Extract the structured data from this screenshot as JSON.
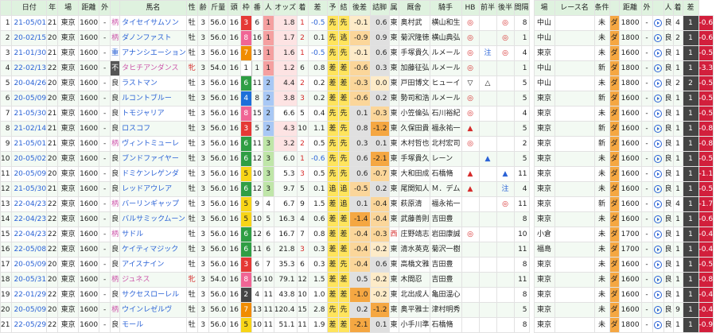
{
  "header": [
    "日付",
    "年",
    "場",
    "距離",
    "外",
    "",
    "馬名",
    "性",
    "齢",
    "斤量",
    "頭",
    "枠",
    "番",
    "人",
    "オッズ",
    "着",
    "差",
    "予",
    "結",
    "後差",
    "詰脚",
    "属",
    "厩舎",
    "騎手",
    "HB",
    "前半",
    "後半",
    "間隔",
    "",
    "場",
    "レース名",
    "条件",
    "",
    "距離",
    "外",
    "",
    "人",
    "着",
    "差"
  ],
  "rows": [
    {
      "no": "1",
      "date": "21-05/01",
      "year": "21",
      "place": "東京",
      "dist": "1600",
      "out": "-",
      "mark": "柄",
      "name": "タイセイサムソン",
      "sex": "牡",
      "age": "3",
      "kin": "56.0",
      "heads": "16",
      "waku": "3",
      "ban": "6",
      "pop": "1",
      "odds": "1.8",
      "chaku": "1",
      "sa": "-0.5",
      "yo": "先",
      "ke": "先",
      "gosa": "-0.1",
      "tsume": "0.6",
      "zoku": "東",
      "stable": "奥村武",
      "jockey": "横山和生",
      "hb": "◎",
      "zen": "",
      "kou": "◎",
      "kan": "8",
      "p_place": "中山",
      "race": "",
      "cond": "未",
      "cmark": "ダ",
      "p_dist": "1800",
      "p_out": "-",
      "p_g": "良",
      "p_pop": "4",
      "p_chaku": "1",
      "p_sa": "-0.6"
    },
    {
      "no": "2",
      "date": "20-02/15",
      "year": "20",
      "place": "東京",
      "dist": "1600",
      "out": "-",
      "mark": "柄",
      "name": "ダノンファスト",
      "sex": "牡",
      "age": "3",
      "kin": "56.0",
      "heads": "16",
      "waku": "8",
      "ban": "16",
      "pop": "1",
      "odds": "1.7",
      "chaku": "2",
      "sa": "0.1",
      "yo": "先",
      "ke": "逃",
      "gosa": "-0.9",
      "tsume": "0.9",
      "zoku": "東",
      "stable": "菊沢隆徳",
      "jockey": "横山典弘",
      "hb": "◎",
      "zen": "",
      "kou": "◎",
      "kan": "1",
      "p_place": "中山",
      "race": "",
      "cond": "未",
      "cmark": "ダ",
      "p_dist": "1800",
      "p_out": "-",
      "p_g": "良",
      "p_pop": "2",
      "p_chaku": "1",
      "p_sa": "-0.6"
    },
    {
      "no": "3",
      "date": "21-01/30",
      "year": "21",
      "place": "東京",
      "dist": "1600",
      "out": "-",
      "mark": "重",
      "name": "アナンシエーション",
      "sex": "牡",
      "age": "3",
      "kin": "56.0",
      "heads": "16",
      "waku": "7",
      "ban": "13",
      "pop": "1",
      "odds": "1.6",
      "chaku": "1",
      "sa": "-0.5",
      "yo": "先",
      "ke": "先",
      "gosa": "-0.1",
      "tsume": "0.6",
      "zoku": "東",
      "stable": "手塚貴久",
      "jockey": "ルメール",
      "hb": "◎",
      "zen": "注",
      "kou": "◎",
      "kan": "4",
      "p_place": "東京",
      "race": "",
      "cond": "未",
      "cmark": "ダ",
      "p_dist": "1600",
      "p_out": "-",
      "p_g": "良",
      "p_pop": "1",
      "p_chaku": "1",
      "p_sa": "-0.5"
    },
    {
      "no": "4",
      "date": "22-02/13",
      "year": "22",
      "place": "東京",
      "dist": "1600",
      "out": "-",
      "mark": "不",
      "name": "タヒチアンダンス",
      "sex": "牝",
      "age": "3",
      "kin": "54.0",
      "heads": "16",
      "waku": "1",
      "ban": "1",
      "pop": "1",
      "odds": "1.2",
      "chaku": "6",
      "sa": "0.8",
      "yo": "差",
      "ke": "差",
      "gosa": "-0.6",
      "tsume": "0.3",
      "zoku": "東",
      "stable": "加藤征弘",
      "jockey": "ルメール",
      "hb": "◎",
      "zen": "",
      "kou": "",
      "kan": "1",
      "p_place": "中山",
      "race": "",
      "cond": "新",
      "cmark": "ダ",
      "p_dist": "1800",
      "p_out": "-",
      "p_g": "良",
      "p_pop": "1",
      "p_chaku": "1",
      "p_sa": "-3.3"
    },
    {
      "no": "5",
      "date": "20-04/26",
      "year": "20",
      "place": "東京",
      "dist": "1600",
      "out": "-",
      "mark": "良",
      "name": "ラストマン",
      "sex": "牡",
      "age": "3",
      "kin": "56.0",
      "heads": "16",
      "waku": "6",
      "ban": "11",
      "pop": "2",
      "odds": "4.4",
      "chaku": "2",
      "sa": "0.2",
      "yo": "差",
      "ke": "差",
      "gosa": "-0.3",
      "tsume": "0.0",
      "zoku": "東",
      "stable": "戸田博文",
      "jockey": "ヒューイ",
      "hb": "▽",
      "zen": "△",
      "kou": "",
      "kan": "5",
      "p_place": "中山",
      "race": "",
      "cond": "未",
      "cmark": "ダ",
      "p_dist": "1800",
      "p_out": "-",
      "p_g": "良",
      "p_pop": "2",
      "p_chaku": "2",
      "p_sa": "-0.5"
    },
    {
      "no": "6",
      "date": "20-05/09",
      "year": "20",
      "place": "東京",
      "dist": "1600",
      "out": "-",
      "mark": "良",
      "name": "ルコントブルー",
      "sex": "牡",
      "age": "3",
      "kin": "56.0",
      "heads": "16",
      "waku": "4",
      "ban": "8",
      "pop": "2",
      "odds": "3.8",
      "chaku": "3",
      "sa": "0.2",
      "yo": "差",
      "ke": "差",
      "gosa": "-0.6",
      "tsume": "0.2",
      "zoku": "東",
      "stable": "勢司和浩",
      "jockey": "ルメール",
      "hb": "◎",
      "zen": "",
      "kou": "",
      "kan": "5",
      "p_place": "東京",
      "race": "",
      "cond": "新",
      "cmark": "ダ",
      "p_dist": "1600",
      "p_out": "-",
      "p_g": "良",
      "p_pop": "1",
      "p_chaku": "1",
      "p_sa": "-0.5"
    },
    {
      "no": "7",
      "date": "21-05/30",
      "year": "21",
      "place": "東京",
      "dist": "1600",
      "out": "-",
      "mark": "良",
      "name": "トモジャリア",
      "sex": "牡",
      "age": "3",
      "kin": "56.0",
      "heads": "16",
      "waku": "8",
      "ban": "15",
      "pop": "2",
      "odds": "6.6",
      "chaku": "5",
      "sa": "0.4",
      "yo": "先",
      "ke": "先",
      "gosa": "0.1",
      "tsume": "-0.3",
      "zoku": "東",
      "stable": "小笠倫弘",
      "jockey": "石川裕紀",
      "hb": "◎",
      "zen": "",
      "kou": "",
      "kan": "4",
      "p_place": "東京",
      "race": "",
      "cond": "未",
      "cmark": "ダ",
      "p_dist": "1600",
      "p_out": "-",
      "p_g": "良",
      "p_pop": "1",
      "p_chaku": "1",
      "p_sa": "-0.5"
    },
    {
      "no": "8",
      "date": "21-02/14",
      "year": "21",
      "place": "東京",
      "dist": "1600",
      "out": "-",
      "mark": "良",
      "name": "ロスコフ",
      "sex": "牡",
      "age": "3",
      "kin": "56.0",
      "heads": "16",
      "waku": "3",
      "ban": "5",
      "pop": "2",
      "odds": "4.3",
      "chaku": "10",
      "sa": "1.1",
      "yo": "差",
      "ke": "先",
      "gosa": "0.8",
      "tsume": "-1.2",
      "zoku": "東",
      "stable": "久保田貴",
      "jockey": "福永祐一",
      "hb": "▲",
      "zen": "",
      "kou": "",
      "kan": "5",
      "p_place": "東京",
      "race": "",
      "cond": "新",
      "cmark": "ダ",
      "p_dist": "1600",
      "p_out": "-",
      "p_g": "良",
      "p_pop": "1",
      "p_chaku": "1",
      "p_sa": "-0.8"
    },
    {
      "no": "9",
      "date": "21-05/01",
      "year": "21",
      "place": "東京",
      "dist": "1600",
      "out": "-",
      "mark": "柄",
      "name": "ヴィントミューレ",
      "sex": "牡",
      "age": "3",
      "kin": "56.0",
      "heads": "16",
      "waku": "6",
      "ban": "11",
      "pop": "3",
      "odds": "3.2",
      "chaku": "2",
      "sa": "0.5",
      "yo": "先",
      "ke": "先",
      "gosa": "0.3",
      "tsume": "0.1",
      "zoku": "東",
      "stable": "木村哲也",
      "jockey": "北村宏司",
      "hb": "◎",
      "zen": "",
      "kou": "",
      "kan": "2",
      "p_place": "東京",
      "race": "",
      "cond": "新",
      "cmark": "ダ",
      "p_dist": "1600",
      "p_out": "-",
      "p_g": "良",
      "p_pop": "1",
      "p_chaku": "1",
      "p_sa": "-0.8"
    },
    {
      "no": "10",
      "date": "20-05/02",
      "year": "20",
      "place": "東京",
      "dist": "1600",
      "out": "-",
      "mark": "良",
      "name": "ブンドファイヤー",
      "sex": "牡",
      "age": "3",
      "kin": "56.0",
      "heads": "16",
      "waku": "6",
      "ban": "12",
      "pop": "3",
      "odds": "6.0",
      "chaku": "1",
      "sa": "-0.6",
      "yo": "先",
      "ke": "先",
      "gosa": "0.6",
      "tsume": "-2.1",
      "zoku": "東",
      "stable": "手塚貴久",
      "jockey": "レーン",
      "hb": "",
      "zen": "▲",
      "kou": "",
      "kan": "5",
      "p_place": "東京",
      "race": "",
      "cond": "未",
      "cmark": "ダ",
      "p_dist": "1600",
      "p_out": "-",
      "p_g": "良",
      "p_pop": "1",
      "p_chaku": "1",
      "p_sa": "-0.5"
    },
    {
      "no": "11",
      "date": "20-05/09",
      "year": "20",
      "place": "東京",
      "dist": "1600",
      "out": "-",
      "mark": "良",
      "name": "ドミケンレゲンダ",
      "sex": "牡",
      "age": "3",
      "kin": "56.0",
      "heads": "16",
      "waku": "5",
      "ban": "10",
      "pop": "3",
      "odds": "5.3",
      "chaku": "3",
      "sa": "0.5",
      "yo": "先",
      "ke": "先",
      "gosa": "0.6",
      "tsume": "-0.7",
      "zoku": "東",
      "stable": "大和田成",
      "jockey": "石橋脩",
      "hb": "▲",
      "zen": "",
      "kou": "▲",
      "kan": "11",
      "p_place": "東京",
      "race": "",
      "cond": "未",
      "cmark": "ダ",
      "p_dist": "1600",
      "p_out": "-",
      "p_g": "良",
      "p_pop": "1",
      "p_chaku": "1",
      "p_sa": "-1.1"
    },
    {
      "no": "12",
      "date": "21-05/30",
      "year": "21",
      "place": "東京",
      "dist": "1600",
      "out": "-",
      "mark": "良",
      "name": "レッドアウレア",
      "sex": "牡",
      "age": "3",
      "kin": "56.0",
      "heads": "16",
      "waku": "6",
      "ban": "12",
      "pop": "3",
      "odds": "9.7",
      "chaku": "5",
      "sa": "0.1",
      "yo": "追",
      "ke": "追",
      "gosa": "-0.5",
      "tsume": "0.2",
      "zoku": "東",
      "stable": "尾関知人",
      "jockey": "Ｍ．デム",
      "hb": "▲",
      "zen": "",
      "kou": "注",
      "kan": "4",
      "p_place": "東京",
      "race": "",
      "cond": "未",
      "cmark": "ダ",
      "p_dist": "1600",
      "p_out": "-",
      "p_g": "良",
      "p_pop": "1",
      "p_chaku": "1",
      "p_sa": "-0.5"
    },
    {
      "no": "13",
      "date": "22-04/23",
      "year": "22",
      "place": "東京",
      "dist": "1600",
      "out": "-",
      "mark": "柄",
      "name": "バーリンギャップ",
      "sex": "牡",
      "age": "3",
      "kin": "56.0",
      "heads": "16",
      "waku": "5",
      "ban": "9",
      "pop": "4",
      "odds": "6.7",
      "chaku": "9",
      "sa": "1.5",
      "yo": "差",
      "ke": "追",
      "gosa": "0.1",
      "tsume": "-0.4",
      "zoku": "東",
      "stable": "萩原清",
      "jockey": "福永祐一",
      "hb": "",
      "zen": "",
      "kou": "◎",
      "kan": "11",
      "p_place": "東京",
      "race": "",
      "cond": "新",
      "cmark": "ダ",
      "p_dist": "1600",
      "p_out": "-",
      "p_g": "良",
      "p_pop": "4",
      "p_chaku": "1",
      "p_sa": "-1.7"
    },
    {
      "no": "14",
      "date": "22-04/23",
      "year": "22",
      "place": "東京",
      "dist": "1600",
      "out": "-",
      "mark": "良",
      "name": "バルサミックムーン",
      "sex": "牡",
      "age": "3",
      "kin": "56.0",
      "heads": "16",
      "waku": "5",
      "ban": "10",
      "pop": "5",
      "odds": "16.3",
      "chaku": "4",
      "sa": "0.6",
      "yo": "差",
      "ke": "差",
      "gosa": "-1.4",
      "tsume": "-0.4",
      "zoku": "東",
      "stable": "武藤善則",
      "jockey": "吉田豊",
      "hb": "",
      "zen": "",
      "kou": "",
      "kan": "8",
      "p_place": "東京",
      "race": "",
      "cond": "未",
      "cmark": "ダ",
      "p_dist": "1600",
      "p_out": "-",
      "p_g": "良",
      "p_pop": "1",
      "p_chaku": "1",
      "p_sa": "-0.6"
    },
    {
      "no": "15",
      "date": "22-04/23",
      "year": "22",
      "place": "東京",
      "dist": "1600",
      "out": "-",
      "mark": "柄",
      "name": "サドル",
      "sex": "牡",
      "age": "3",
      "kin": "56.0",
      "heads": "16",
      "waku": "6",
      "ban": "12",
      "pop": "6",
      "odds": "16.7",
      "chaku": "7",
      "sa": "0.8",
      "yo": "差",
      "ke": "差",
      "gosa": "-0.4",
      "tsume": "-0.3",
      "zoku": "西",
      "stable": "庄野靖志",
      "jockey": "岩田康誠",
      "hb": "◎",
      "zen": "",
      "kou": "",
      "kan": "10",
      "p_place": "小倉",
      "race": "",
      "cond": "未",
      "cmark": "ダ",
      "p_dist": "1700",
      "p_out": "-",
      "p_g": "良",
      "p_pop": "1",
      "p_chaku": "1",
      "p_sa": "-0.4"
    },
    {
      "no": "16",
      "date": "22-05/08",
      "year": "22",
      "place": "東京",
      "dist": "1600",
      "out": "-",
      "mark": "良",
      "name": "ケイティマジック",
      "sex": "牡",
      "age": "3",
      "kin": "56.0",
      "heads": "16",
      "waku": "6",
      "ban": "11",
      "pop": "6",
      "odds": "21.8",
      "chaku": "3",
      "sa": "0.3",
      "yo": "差",
      "ke": "差",
      "gosa": "-0.4",
      "tsume": "-0.2",
      "zoku": "東",
      "stable": "清水英克",
      "jockey": "菊沢一樹",
      "hb": "",
      "zen": "",
      "kou": "",
      "kan": "11",
      "p_place": "福島",
      "race": "",
      "cond": "未",
      "cmark": "ダ",
      "p_dist": "1700",
      "p_out": "-",
      "p_g": "良",
      "p_pop": "1",
      "p_chaku": "1",
      "p_sa": "-0.4"
    },
    {
      "no": "17",
      "date": "20-05/09",
      "year": "20",
      "place": "東京",
      "dist": "1600",
      "out": "-",
      "mark": "良",
      "name": "アイスナイン",
      "sex": "牡",
      "age": "3",
      "kin": "56.0",
      "heads": "16",
      "waku": "3",
      "ban": "6",
      "pop": "7",
      "odds": "35.3",
      "chaku": "6",
      "sa": "0.3",
      "yo": "差",
      "ke": "先",
      "gosa": "-0.4",
      "tsume": "0.6",
      "zoku": "東",
      "stable": "高橋文雅",
      "jockey": "吉田豊",
      "hb": "",
      "zen": "",
      "kou": "",
      "kan": "8",
      "p_place": "東京",
      "race": "",
      "cond": "未",
      "cmark": "ダ",
      "p_dist": "1600",
      "p_out": "-",
      "p_g": "良",
      "p_pop": "1",
      "p_chaku": "1",
      "p_sa": "-0.5"
    },
    {
      "no": "18",
      "date": "20-05/31",
      "year": "20",
      "place": "東京",
      "dist": "1600",
      "out": "-",
      "mark": "柄",
      "name": "ジュネス",
      "sex": "牝",
      "age": "3",
      "kin": "54.0",
      "heads": "16",
      "waku": "8",
      "ban": "16",
      "pop": "10",
      "odds": "79.1",
      "chaku": "12",
      "sa": "1.5",
      "yo": "差",
      "ke": "差",
      "gosa": "0.5",
      "tsume": "-0.2",
      "zoku": "東",
      "stable": "木間忍",
      "jockey": "吉田豊",
      "hb": "",
      "zen": "",
      "kou": "",
      "kan": "11",
      "p_place": "東京",
      "race": "",
      "cond": "未",
      "cmark": "ダ",
      "p_dist": "1600",
      "p_out": "-",
      "p_g": "良",
      "p_pop": "1",
      "p_chaku": "1",
      "p_sa": "-0.8"
    },
    {
      "no": "19",
      "date": "22-01/29",
      "year": "22",
      "place": "東京",
      "dist": "1600",
      "out": "-",
      "mark": "良",
      "name": "サクセスローレル",
      "sex": "牡",
      "age": "3",
      "kin": "56.0",
      "heads": "16",
      "waku": "2",
      "ban": "4",
      "pop": "11",
      "odds": "43.8",
      "chaku": "10",
      "sa": "1.0",
      "yo": "差",
      "ke": "差",
      "gosa": "-1.0",
      "tsume": "-0.2",
      "zoku": "東",
      "stable": "北出成人",
      "jockey": "亀田温心",
      "hb": "",
      "zen": "",
      "kou": "",
      "kan": "8",
      "p_place": "東京",
      "race": "",
      "cond": "未",
      "cmark": "ダ",
      "p_dist": "1600",
      "p_out": "-",
      "p_g": "良",
      "p_pop": "1",
      "p_chaku": "1",
      "p_sa": "-0.4"
    },
    {
      "no": "20",
      "date": "20-05/09",
      "year": "20",
      "place": "東京",
      "dist": "1600",
      "out": "-",
      "mark": "柄",
      "name": "ウインレゼルヴ",
      "sex": "牡",
      "age": "3",
      "kin": "56.0",
      "heads": "16",
      "waku": "7",
      "ban": "13",
      "pop": "11",
      "odds": "120.4",
      "chaku": "15",
      "sa": "2.8",
      "yo": "先",
      "ke": "先",
      "gosa": "0.2",
      "tsume": "-1.2",
      "zoku": "東",
      "stable": "奥平雅士",
      "jockey": "津村明秀",
      "hb": "",
      "zen": "",
      "kou": "",
      "kan": "5",
      "p_place": "東京",
      "race": "",
      "cond": "未",
      "cmark": "ダ",
      "p_dist": "1600",
      "p_out": "-",
      "p_g": "良",
      "p_pop": "9",
      "p_chaku": "1",
      "p_sa": "-0.4"
    },
    {
      "no": "21",
      "date": "22-05/29",
      "year": "22",
      "place": "東京",
      "dist": "1600",
      "out": "-",
      "mark": "良",
      "name": "モール",
      "sex": "牡",
      "age": "3",
      "kin": "56.0",
      "heads": "16",
      "waku": "5",
      "ban": "10",
      "pop": "11",
      "odds": "51.1",
      "chaku": "11",
      "sa": "1.9",
      "yo": "差",
      "ke": "差",
      "gosa": "-2.1",
      "tsume": "0.1",
      "zoku": "東",
      "stable": "小手川準",
      "jockey": "石橋脩",
      "hb": "",
      "zen": "",
      "kou": "",
      "kan": "8",
      "p_place": "東京",
      "race": "",
      "cond": "未",
      "cmark": "ダ",
      "p_dist": "1800",
      "p_out": "-",
      "p_g": "良",
      "p_pop": "1",
      "p_chaku": "1",
      "p_sa": "-0.9"
    }
  ]
}
